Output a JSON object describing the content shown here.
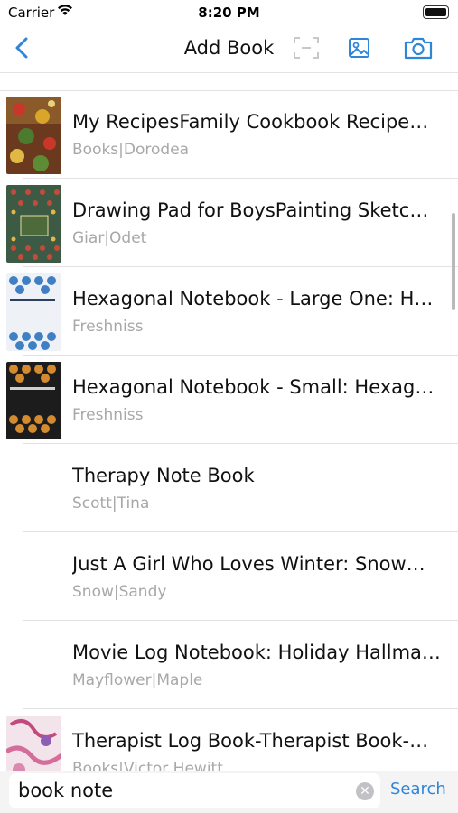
{
  "status": {
    "carrier": "Carrier",
    "time": "8:20 PM"
  },
  "nav": {
    "title": "Add Book"
  },
  "colors": {
    "accent": "#2e86d8",
    "subtitle": "#a8a8a8"
  },
  "books": [
    {
      "title": "My RecipesFamily Cookbook Recipe…",
      "subtitle": "Books|Dorodea"
    },
    {
      "title": "Drawing Pad for BoysPainting Sketc…",
      "subtitle": "Giar|Odet"
    },
    {
      "title": "Hexagonal Notebook - Large One: He…",
      "subtitle": "Freshniss"
    },
    {
      "title": "Hexagonal Notebook - Small: Hexago…",
      "subtitle": "Freshniss"
    },
    {
      "title": "Therapy Note Book",
      "subtitle": "Scott|Tina"
    },
    {
      "title": "Just A Girl Who Loves Winter: Snow…",
      "subtitle": "Snow|Sandy"
    },
    {
      "title": "Movie Log Notebook: Holiday Hallmar…",
      "subtitle": "Mayflower|Maple"
    },
    {
      "title": "Therapist Log Book-Therapist Book-…",
      "subtitle": "Books|Victor Hewitt"
    }
  ],
  "search": {
    "value": "book note",
    "button_label": "Search"
  },
  "icons": {
    "back": "chevron-left-icon",
    "scan": "scan-frame-icon",
    "photo": "photo-library-icon",
    "camera": "camera-icon",
    "clear": "clear-circle-icon"
  }
}
